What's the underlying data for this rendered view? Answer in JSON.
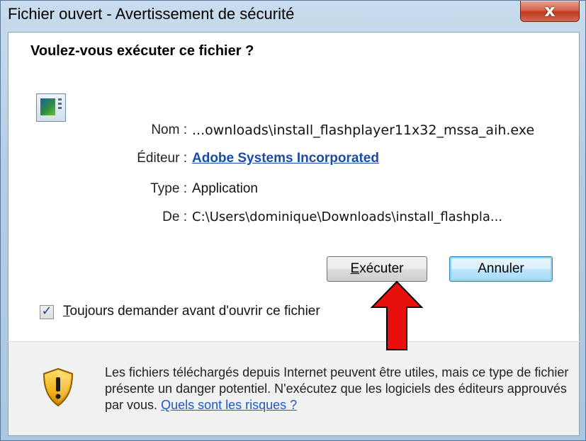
{
  "window": {
    "title": "Fichier ouvert - Avertissement de sécurité",
    "close_glyph": "x"
  },
  "dialog": {
    "question": "Voulez-vous exécuter ce fichier ?",
    "icon": "application-icon",
    "fields": {
      "name_label": "Nom :",
      "name_value": "...ownloads\\install_flashplayer11x32_mssa_aih.exe",
      "publisher_label": "Éditeur :",
      "publisher_value": "Adobe Systems Incorporated",
      "type_label": "Type :",
      "type_value": "Application",
      "from_label": "De :",
      "from_value": "C:\\Users\\dominique\\Downloads\\install_flashpla..."
    },
    "buttons": {
      "run_mnemonic": "E",
      "run_rest": "xécuter",
      "cancel": "Annuler"
    },
    "checkbox": {
      "mnemonic": "T",
      "rest": "oujours demander avant d'ouvrir ce fichier",
      "checked": true
    },
    "warning": {
      "icon": "shield-warning-icon",
      "text": "Les fichiers téléchargés depuis Internet peuvent être utiles, mais ce type de fichier présente un danger potentiel. N'exécutez que les logiciels des éditeurs approuvés par vous.",
      "link": "Quels sont les risques ?"
    }
  },
  "annotation": {
    "icon": "red-up-arrow",
    "color": "#e8100c"
  }
}
